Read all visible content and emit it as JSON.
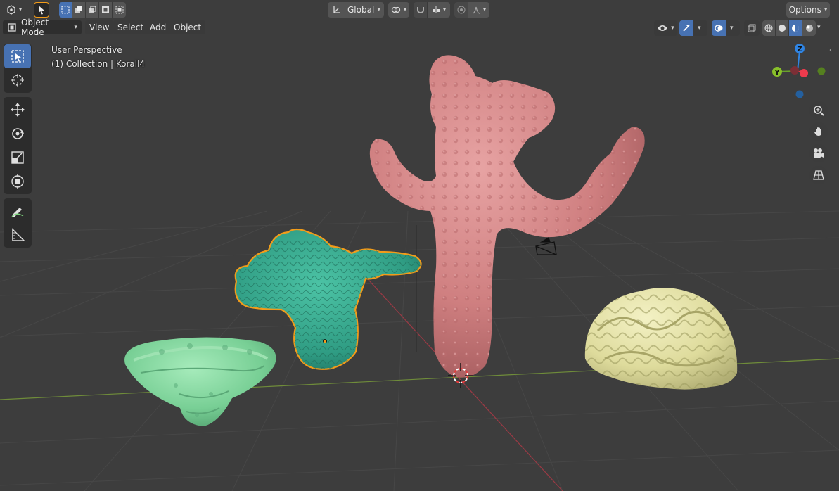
{
  "header": {
    "transform_orientation": "Global",
    "options_label": "Options"
  },
  "mode_bar": {
    "mode_label": "Object Mode",
    "menus": [
      "View",
      "Select",
      "Add",
      "Object"
    ]
  },
  "overlay": {
    "view_name": "User Perspective",
    "collection_info": "(1) Collection | Korall4"
  },
  "gizmo": {
    "x_label": "X",
    "y_label": "Y",
    "z_label": "Z"
  },
  "colors": {
    "accent": "#4772b3",
    "x_axis": "#ed3b4d",
    "y_axis": "#6aa22a",
    "z_axis": "#2f84e3",
    "coral_pink": "#d98a8a",
    "coral_teal": "#35a98f",
    "coral_mint": "#7fd6a0",
    "coral_cream": "#e6e3a8",
    "selection_outline": "#f29c1a"
  },
  "toolbar": {
    "tools": [
      "select-box",
      "cursor",
      "move",
      "rotate",
      "scale",
      "transform",
      "annotate",
      "measure"
    ]
  }
}
